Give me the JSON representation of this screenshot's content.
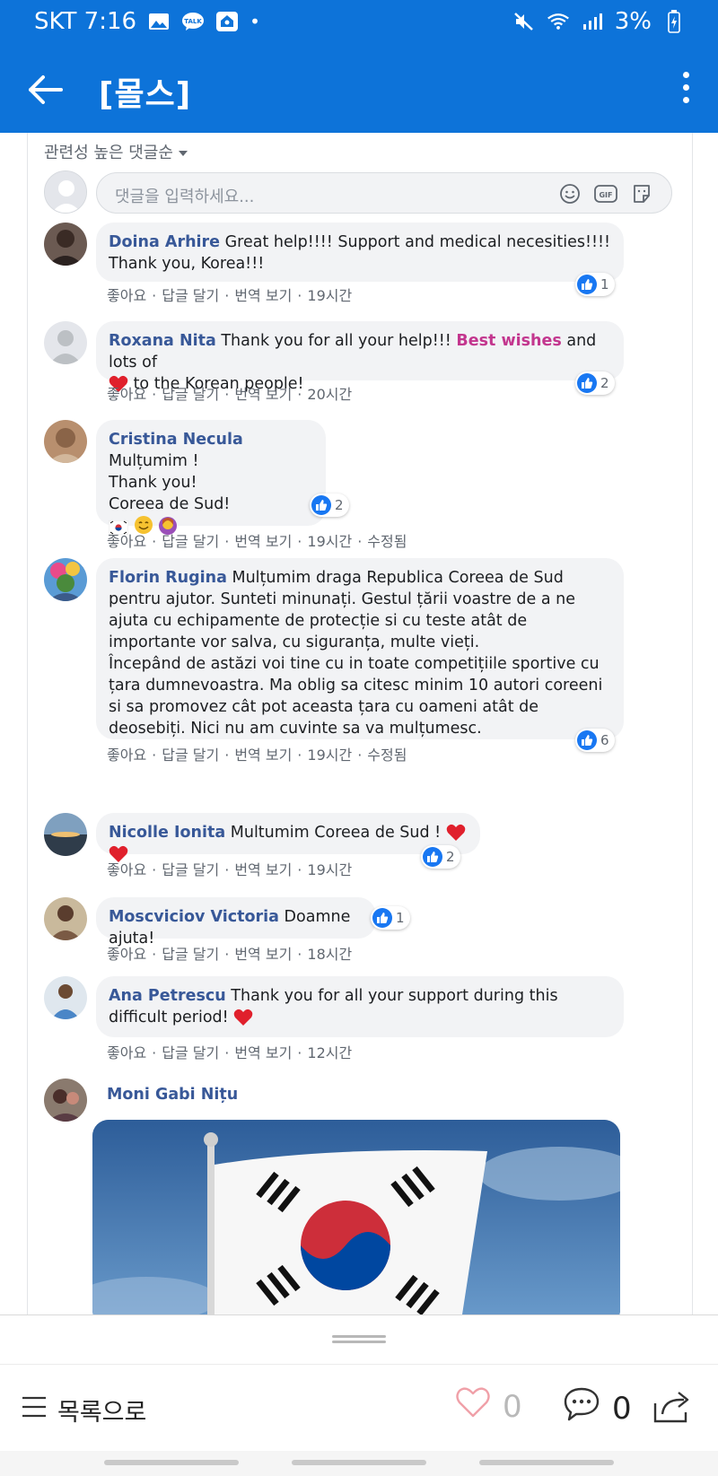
{
  "status": {
    "carrier_time": "SKT 7:16",
    "battery": "3%",
    "dot": "•"
  },
  "appbar": {
    "title": "[몰스]"
  },
  "fb": {
    "sort_label": "관련성 높은 댓글순",
    "composer_placeholder": "댓글을 입력하세요...",
    "comments": [
      {
        "author": "Doina Arhire",
        "text": "Great help!!!! Support and medical necesities!!!! Thank you, Korea!!!",
        "like": "좋아요",
        "reply": "답글 달기",
        "translate": "번역 보기",
        "time": "19시간",
        "reactions": "1"
      },
      {
        "author": "Roxana Nita",
        "text_a": "Thank you for all your help!!! ",
        "highlight": "Best wishes",
        "text_b": " and lots of",
        "text_c": " to the Korean people!",
        "like": "좋아요",
        "reply": "답글 달기",
        "translate": "번역 보기",
        "time": "20시간",
        "reactions": "2"
      },
      {
        "author": "Cristina Necula",
        "line1": "Mulțumim !",
        "line2": "Thank you!",
        "line3": "Coreea de Sud!",
        "like": "좋아요",
        "reply": "답글 달기",
        "translate": "번역 보기",
        "time": "19시간",
        "edited": "수정됨",
        "reactions": "2"
      },
      {
        "author": "Florin Rugina",
        "text": "Mulțumim draga Republica Coreea de Sud pentru ajutor. Sunteti minunați. Gestul țării voastre de a ne ajuta cu echipamente de protecție si cu teste atât de importante vor salva, cu siguranța, multe vieți.",
        "text2": "Începând de astăzi voi tine cu in toate competițiile sportive cu țara dumnevoastra. Ma oblig sa citesc minim 10 autori coreeni si sa promovez cât pot aceasta țara cu oameni atât de deosebiți. Nici nu am cuvinte sa va mulțumesc.",
        "like": "좋아요",
        "reply": "답글 달기",
        "translate": "번역 보기",
        "time": "19시간",
        "edited": "수정됨",
        "reactions": "6"
      },
      {
        "author": "Nicolle Ionita",
        "text": "Multumim Coreea de Sud !",
        "like": "좋아요",
        "reply": "답글 달기",
        "translate": "번역 보기",
        "time": "19시간",
        "reactions": "2"
      },
      {
        "author": "Moscviciov Victoria",
        "text": "Doamne ajuta!",
        "like": "좋아요",
        "reply": "답글 달기",
        "translate": "번역 보기",
        "time": "18시간",
        "reactions": "1"
      },
      {
        "author": "Ana Petrescu",
        "text": "Thank you for all your support during this difficult period!",
        "like": "좋아요",
        "reply": "답글 달기",
        "translate": "번역 보기",
        "time": "12시간"
      },
      {
        "author": "Moni Gabi Nițu"
      }
    ]
  },
  "bottom": {
    "list_label": "목록으로",
    "like_count": "0",
    "comment_count": "0"
  },
  "colors": {
    "brand": "#0d73d9",
    "author": "#385898",
    "like": "#1877f2",
    "highlight": "#c3368e"
  }
}
